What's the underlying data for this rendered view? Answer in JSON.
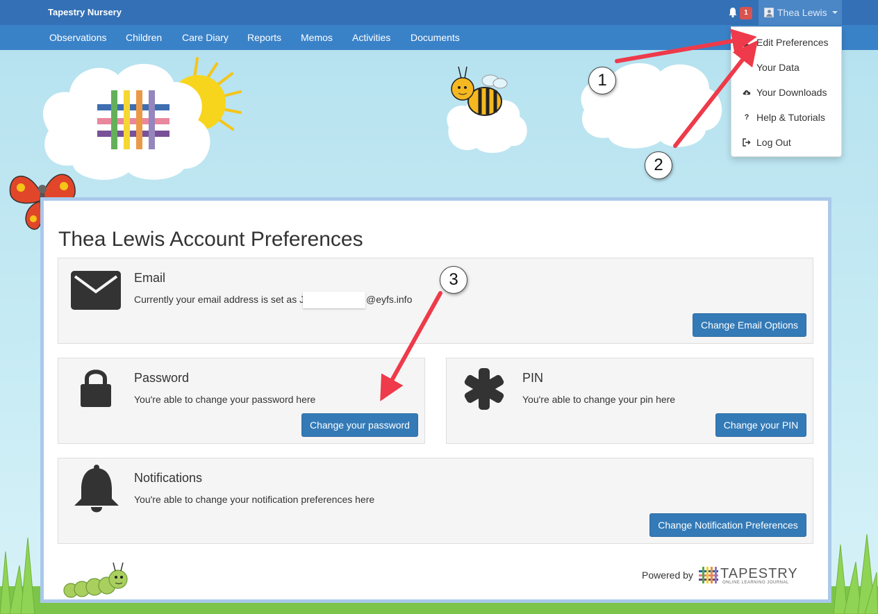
{
  "app": {
    "name": "Tapestry Nursery"
  },
  "header": {
    "notification_count": "1",
    "user_name": "Thea Lewis"
  },
  "nav": {
    "items": [
      "Observations",
      "Children",
      "Care Diary",
      "Reports",
      "Memos",
      "Activities",
      "Documents"
    ]
  },
  "user_menu": {
    "items": [
      {
        "label": "Edit Preferences",
        "icon": "user-icon"
      },
      {
        "label": "Your Data",
        "icon": "data-icon"
      },
      {
        "label": "Your Downloads",
        "icon": "cloud-download-icon"
      },
      {
        "label": "Help & Tutorials",
        "icon": "question-icon"
      },
      {
        "label": "Log Out",
        "icon": "log-out-icon"
      }
    ]
  },
  "page": {
    "title": "Thea Lewis Account Preferences"
  },
  "email": {
    "title": "Email",
    "text_prefix": "Currently your email address is set as J",
    "text_suffix": "@eyfs.info",
    "button": "Change Email Options",
    "icon": "envelope-icon"
  },
  "password": {
    "title": "Password",
    "text": "You're able to change your password here",
    "button": "Change your password",
    "icon": "lock-icon"
  },
  "pin": {
    "title": "PIN",
    "text": "You're able to change your pin here",
    "button": "Change your PIN",
    "icon": "asterisk-icon"
  },
  "notifications": {
    "title": "Notifications",
    "text": "You're able to change your notification preferences here",
    "button": "Change Notification Preferences",
    "icon": "bell-icon"
  },
  "footer": {
    "powered_by": "Powered by",
    "logo_text": "TAPESTRY",
    "logo_sub": "ONLINE LEARNING JOURNAL"
  },
  "annotations": {
    "callouts": [
      "1",
      "2",
      "3"
    ],
    "arrow_color": "#ee3a4a"
  },
  "colors": {
    "topbar": "#3470b5",
    "navbar": "#3a82c8",
    "button": "#337ab7",
    "panel_border": "#a9c9ea"
  }
}
